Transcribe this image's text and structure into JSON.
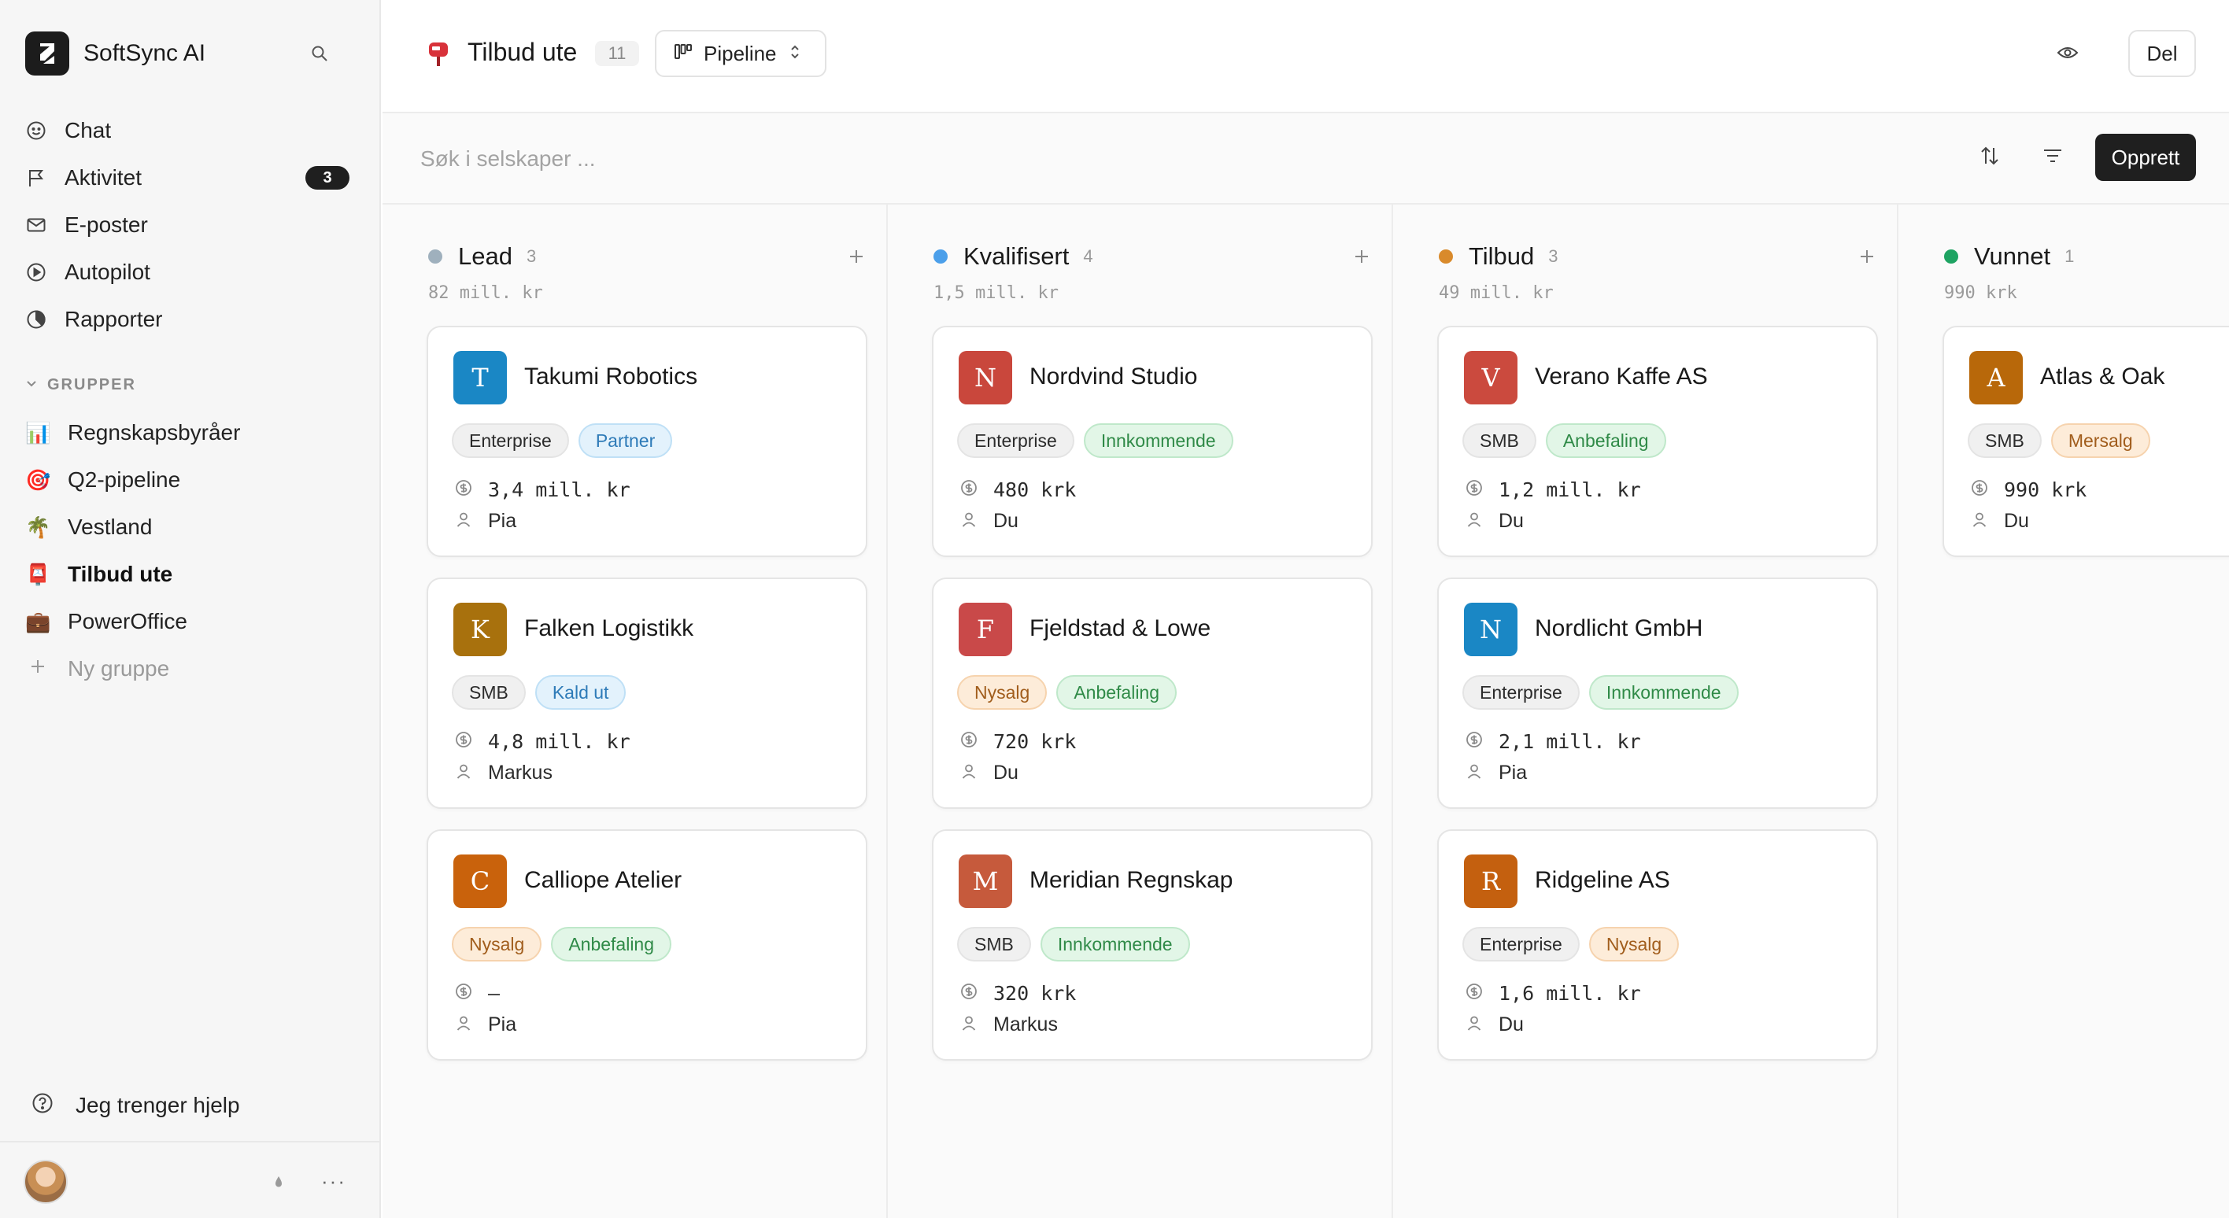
{
  "app": {
    "name": "SoftSync AI"
  },
  "sidebar": {
    "nav": [
      {
        "label": "Chat",
        "icon": "smiley-icon"
      },
      {
        "label": "Aktivitet",
        "icon": "flag-icon",
        "badge": "3"
      },
      {
        "label": "E-poster",
        "icon": "mail-icon"
      },
      {
        "label": "Autopilot",
        "icon": "play-circle-icon"
      },
      {
        "label": "Rapporter",
        "icon": "pie-chart-icon"
      }
    ],
    "groups_title": "GRUPPER",
    "groups": [
      {
        "label": "Regnskapsbyråer",
        "emoji": "📊"
      },
      {
        "label": "Q2-pipeline",
        "emoji": "🎯"
      },
      {
        "label": "Vestland",
        "emoji": "🌴"
      },
      {
        "label": "Tilbud ute",
        "emoji": "📮"
      },
      {
        "label": "PowerOffice",
        "emoji": "💼"
      }
    ],
    "new_group": "Ny gruppe",
    "help": "Jeg trenger hjelp"
  },
  "header": {
    "title": "Tilbud ute",
    "count": "11",
    "view": "Pipeline",
    "share": "Del"
  },
  "toolbar": {
    "search_placeholder": "Søk i selskaper ...",
    "create": "Opprett"
  },
  "colors": {
    "lead": "#9fb0bd",
    "kvalifisert": "#4b9fea",
    "tilbud": "#d98a2b",
    "vunnet": "#1ea362"
  },
  "columns": [
    {
      "name": "Lead",
      "count": "3",
      "total": "82 mill. kr",
      "dot": "#9fb0bd",
      "cards": [
        {
          "letter": "T",
          "color": "#1a87c5",
          "name": "Takumi Robotics",
          "tags": [
            [
              "Enterprise",
              "gray"
            ],
            [
              "Partner",
              "blue"
            ]
          ],
          "value": "3,4 mill. kr",
          "owner": "Pia"
        },
        {
          "letter": "K",
          "color": "#a8710d",
          "name": "Falken Logistikk",
          "tags": [
            [
              "SMB",
              "gray"
            ],
            [
              "Kald ut",
              "blue"
            ]
          ],
          "value": "4,8 mill. kr",
          "owner": "Markus"
        },
        {
          "letter": "C",
          "color": "#c9620c",
          "name": "Calliope Atelier",
          "tags": [
            [
              "Nysalg",
              "orange"
            ],
            [
              "Anbefaling",
              "green"
            ]
          ],
          "value": "—",
          "owner": "Pia"
        }
      ]
    },
    {
      "name": "Kvalifisert",
      "count": "4",
      "total": "1,5 mill. kr",
      "dot": "#4b9fea",
      "cards": [
        {
          "letter": "N",
          "color": "#c9473c",
          "name": "Nordvind Studio",
          "tags": [
            [
              "Enterprise",
              "gray"
            ],
            [
              "Innkommende",
              "green"
            ]
          ],
          "value": "480 krk",
          "owner": "Du"
        },
        {
          "letter": "F",
          "color": "#c94949",
          "name": "Fjeldstad & Lowe",
          "tags": [
            [
              "Nysalg",
              "orange"
            ],
            [
              "Anbefaling",
              "green"
            ]
          ],
          "value": "720 krk",
          "owner": "Du"
        },
        {
          "letter": "M",
          "color": "#c65a3c",
          "name": "Meridian Regnskap",
          "tags": [
            [
              "SMB",
              "gray"
            ],
            [
              "Innkommende",
              "green"
            ]
          ],
          "value": "320 krk",
          "owner": "Markus"
        }
      ]
    },
    {
      "name": "Tilbud",
      "count": "3",
      "total": "49 mill. kr",
      "dot": "#d98a2b",
      "cards": [
        {
          "letter": "V",
          "color": "#cb4a3e",
          "name": "Verano Kaffe AS",
          "tags": [
            [
              "SMB",
              "gray"
            ],
            [
              "Anbefaling",
              "green"
            ]
          ],
          "value": "1,2 mill. kr",
          "owner": "Du"
        },
        {
          "letter": "N",
          "color": "#1a87c5",
          "name": "Nordlicht GmbH",
          "tags": [
            [
              "Enterprise",
              "gray"
            ],
            [
              "Innkommende",
              "green"
            ]
          ],
          "value": "2,1 mill. kr",
          "owner": "Pia"
        },
        {
          "letter": "R",
          "color": "#c4600f",
          "name": "Ridgeline AS",
          "tags": [
            [
              "Enterprise",
              "gray"
            ],
            [
              "Nysalg",
              "orange"
            ]
          ],
          "value": "1,6 mill. kr",
          "owner": "Du"
        }
      ]
    },
    {
      "name": "Vunnet",
      "count": "1",
      "total": "990 krk",
      "dot": "#1ea362",
      "cards": [
        {
          "letter": "A",
          "color": "#b8680a",
          "name": "Atlas & Oak",
          "tags": [
            [
              "SMB",
              "gray"
            ],
            [
              "Mersalg",
              "orange"
            ]
          ],
          "value": "990 krk",
          "owner": "Du"
        }
      ]
    }
  ]
}
